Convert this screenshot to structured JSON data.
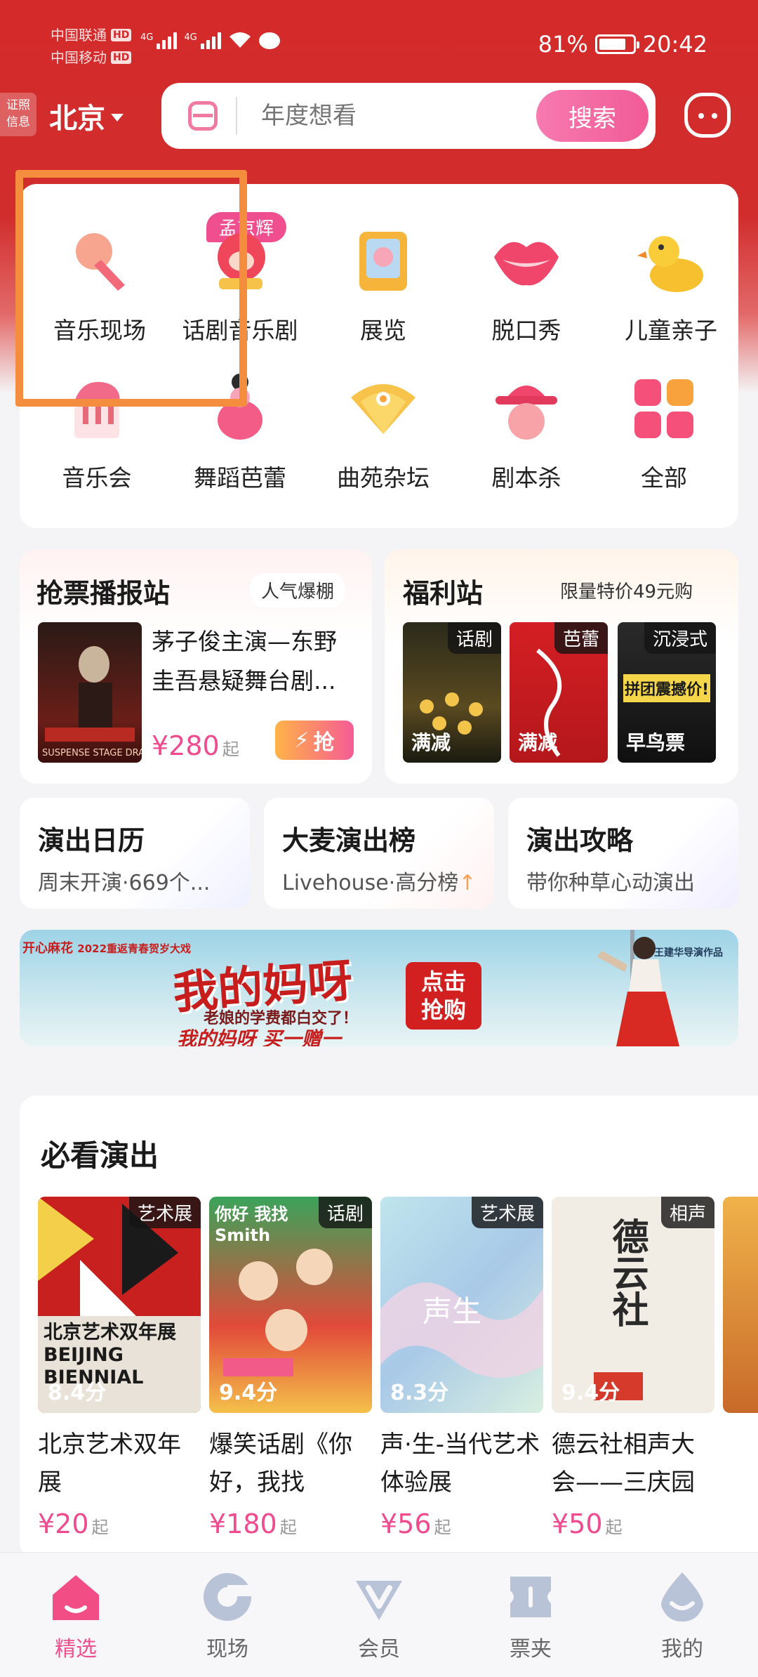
{
  "status_bar": {
    "carrier1": "中国联通",
    "carrier2": "中国移动",
    "hd": "HD",
    "net1": "4G",
    "net2": "4G",
    "battery": "81%",
    "time": "20:42"
  },
  "header": {
    "license": [
      "证照",
      "信息"
    ],
    "city": "北京",
    "search_placeholder": "年度想看",
    "search_button": "搜索"
  },
  "categories": {
    "badge": "孟京辉",
    "items": [
      {
        "label": "音乐现场",
        "icon": "microphone-icon"
      },
      {
        "label": "话剧音乐剧",
        "icon": "theater-mask-icon"
      },
      {
        "label": "展览",
        "icon": "picture-frame-icon"
      },
      {
        "label": "脱口秀",
        "icon": "lips-icon"
      },
      {
        "label": "儿童亲子",
        "icon": "rubber-duck-icon"
      },
      {
        "label": "音乐会",
        "icon": "piano-icon"
      },
      {
        "label": "舞蹈芭蕾",
        "icon": "dancer-icon"
      },
      {
        "label": "曲苑杂坛",
        "icon": "folding-fan-icon"
      },
      {
        "label": "剧本杀",
        "icon": "detective-hat-icon"
      },
      {
        "label": "全部",
        "icon": "grid-icon"
      }
    ]
  },
  "ticket_station": {
    "title": "抢票播报站",
    "tag": "人气爆棚",
    "show_title": "茅子俊主演—东野圭吾悬疑舞台剧...",
    "poster_text": "SUSPENSE STAGE DRAMA",
    "price": "¥280",
    "price_suffix": "起",
    "grab": "抢"
  },
  "welfare": {
    "title": "福利站",
    "tag": "限量特价49元购",
    "posters": [
      {
        "tag": "话剧",
        "foot": "满减"
      },
      {
        "tag": "芭蕾",
        "foot": "满减"
      },
      {
        "tag": "沉浸式",
        "foot": "早鸟票",
        "art_text": "拼团震撼价!"
      }
    ]
  },
  "mini_cards": [
    {
      "title": "演出日历",
      "sub": "周末开演·669个..."
    },
    {
      "title": "大麦演出榜",
      "sub": "Livehouse·高分榜"
    },
    {
      "title": "演出攻略",
      "sub": "带你种草心动演出"
    }
  ],
  "banner": {
    "brand": "开心麻花",
    "brand_sub": "2022重返青春贺岁大戏",
    "headline": "我的妈呀",
    "tagline": "老娘的学费都白交了！",
    "offer": "我的妈呀 买一赠一",
    "cta_line1": "点击",
    "cta_line2": "抢购",
    "corner": "王建华导演作品"
  },
  "must_see": {
    "title": "必看演出",
    "shows": [
      {
        "tag": "艺术展",
        "score": "8.4分",
        "name": "北京艺术双年展",
        "price": "¥20",
        "suffix": "起",
        "poster_text": "北京艺术双年展 BEIJING BIENNIAL"
      },
      {
        "tag": "话剧",
        "score": "9.4分",
        "name": "爆笑话剧《你好，我找Smi...",
        "price": "¥180",
        "suffix": "起",
        "poster_text": "你好 我找 Smith"
      },
      {
        "tag": "艺术展",
        "score": "8.3分",
        "name": "声·生-当代艺术体验展",
        "price": "¥56",
        "suffix": "起",
        "poster_text": "声生"
      },
      {
        "tag": "相声",
        "score": "9.4分",
        "name": "德云社相声大会——三庆园",
        "price": "¥50",
        "suffix": "起",
        "poster_text": "德云社"
      }
    ]
  },
  "nav": [
    {
      "label": "精选",
      "icon": "home-icon",
      "active": true
    },
    {
      "label": "现场",
      "icon": "live-icon",
      "active": false
    },
    {
      "label": "会员",
      "icon": "member-icon",
      "active": false
    },
    {
      "label": "票夹",
      "icon": "ticket-icon",
      "active": false
    },
    {
      "label": "我的",
      "icon": "profile-icon",
      "active": false
    }
  ],
  "colors": {
    "header_red": "#d42a2a",
    "accent_pink": "#ef4f8f",
    "highlight_orange": "#f58d3f"
  }
}
